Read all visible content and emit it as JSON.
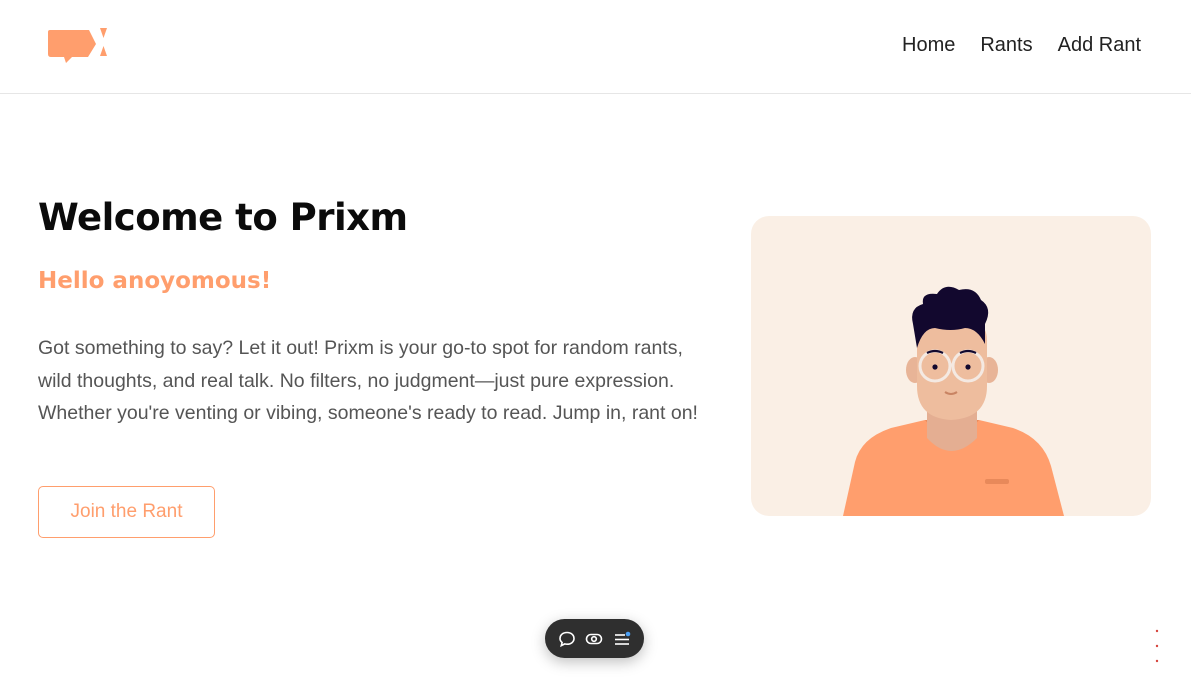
{
  "navbar": {
    "logo_icon": "speech-bubble-logo",
    "links": [
      {
        "label": "Home"
      },
      {
        "label": "Rants"
      },
      {
        "label": "Add Rant"
      }
    ]
  },
  "hero": {
    "title": "Welcome to Prixm",
    "subtitle": "Hello anoyomous!",
    "description": "Got something to say? Let it out! Prixm is your go-to spot for random rants, wild thoughts, and real talk. No filters, no judgment—just pure expression. Whether you're venting or vibing, someone's ready to read. Jump in, rant on!",
    "cta_label": "Join the Rant"
  },
  "toolbar": {
    "items": [
      "comment-icon",
      "eye-toggle-icon",
      "menu-icon"
    ]
  },
  "colors": {
    "accent": "#ff9e6d",
    "illustration_bg": "#faefe5",
    "toolbar_bg": "#2f2f2f"
  }
}
